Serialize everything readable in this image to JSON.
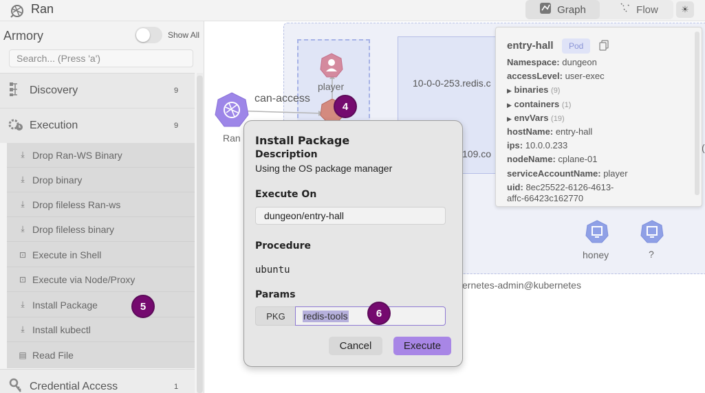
{
  "app": {
    "name": "Ran",
    "logo_icon": "yarn-ball-icon"
  },
  "view_toggle": {
    "graph_label": "Graph",
    "flow_label": "Flow",
    "theme_icon": "sun-icon"
  },
  "sidebar": {
    "title": "Armory",
    "show_all_label": "Show All",
    "show_all_on": false,
    "search_placeholder": "Search... (Press 'a')",
    "categories": [
      {
        "label": "Discovery",
        "count": "9",
        "icon": "hierarchy-icon"
      },
      {
        "label": "Execution",
        "count": "9",
        "icon": "gear-clock-icon"
      },
      {
        "label": "Credential Access",
        "count": "1",
        "icon": "key-icon"
      }
    ],
    "techniques": [
      {
        "label": "Drop Ran-WS Binary",
        "icon": "download-icon"
      },
      {
        "label": "Drop binary",
        "icon": "download-icon"
      },
      {
        "label": "Drop fileless Ran-ws",
        "icon": "download-icon"
      },
      {
        "label": "Drop fileless binary",
        "icon": "download-icon"
      },
      {
        "label": "Execute in Shell",
        "icon": "terminal-icon"
      },
      {
        "label": "Execute via Node/Proxy",
        "icon": "terminal-icon"
      },
      {
        "label": "Install Package",
        "icon": "download-icon"
      },
      {
        "label": "Install kubectl",
        "icon": "download-icon"
      },
      {
        "label": "Read File",
        "icon": "file-icon"
      }
    ]
  },
  "graph": {
    "ran_label": "Ran",
    "edge_label": "can-access",
    "player_label": "player",
    "redis_label": "10-0-0-253.redis.c",
    "redis2_label": "109.co",
    "honey_label": "honey",
    "q_label": "?",
    "cluster_label": "ernetes-admin@kubernetes",
    "right_edge_text": "("
  },
  "markers": {
    "m4": "4",
    "m5": "5",
    "m6": "6"
  },
  "details": {
    "title": "entry-hall",
    "badge": "Pod",
    "rows": {
      "namespace": {
        "k": "Namespace:",
        "v": "dungeon"
      },
      "access": {
        "k": "accessLevel:",
        "v": "user-exec"
      },
      "binaries": {
        "k": "binaries",
        "n": "(9)"
      },
      "containers": {
        "k": "containers",
        "n": "(1)"
      },
      "envvars": {
        "k": "envVars",
        "n": "(19)"
      },
      "hostname": {
        "k": "hostName:",
        "v": "entry-hall"
      },
      "ips": {
        "k": "ips:",
        "v": "10.0.0.233"
      },
      "nodename": {
        "k": "nodeName:",
        "v": "cplane-01"
      },
      "sa": {
        "k": "serviceAccountName:",
        "v": "player"
      },
      "uid": {
        "k": "uid:",
        "v": "8ec25522-6126-4613-",
        "v2": "affc-66423c162770"
      }
    }
  },
  "modal": {
    "title": "Install Package",
    "description_heading": "Description",
    "description": "Using the OS package manager",
    "execute_on_heading": "Execute On",
    "execute_on_value": "dungeon/entry-hall",
    "procedure_heading": "Procedure",
    "procedure_value": "ubuntu",
    "params_heading": "Params",
    "param_label": "PKG",
    "param_value": "redis-tools",
    "cancel_label": "Cancel",
    "execute_label": "Execute"
  },
  "colors": {
    "accent_purple": "#a886e6",
    "marker_purple": "#750a6f",
    "node_purple": "#9d86e8",
    "pod_salmon": "#d48a7f",
    "node_blue": "#8fa0e6"
  }
}
